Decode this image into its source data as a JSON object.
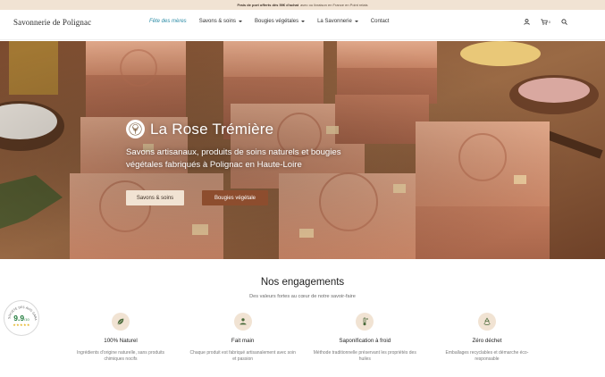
{
  "topbar": {
    "strong": "Frais de port offerts dès 59€ d'achat",
    "rest": "avec ou livraison en France en Point relais"
  },
  "header": {
    "logo": "Savonnerie de Polignac",
    "nav": [
      {
        "label": "Fête des mères",
        "active": true,
        "dropdown": false
      },
      {
        "label": "Savons & soins",
        "active": false,
        "dropdown": true
      },
      {
        "label": "Bougies végétales",
        "active": false,
        "dropdown": true
      },
      {
        "label": "La Savonnerie",
        "active": false,
        "dropdown": true
      },
      {
        "label": "Contact",
        "active": false,
        "dropdown": false
      }
    ],
    "cart_count": "0",
    "icons": [
      "user-icon",
      "cart-icon",
      "search-icon"
    ]
  },
  "hero": {
    "title": "La Rose Trémière",
    "subtitle": "Savons artisanaux, produits de soins naturels et bougies végétales fabriqués à Polignac en Haute-Loire",
    "buttons": [
      {
        "label": "Savons & soins",
        "style": "light"
      },
      {
        "label": "Bougies végétale",
        "style": "dark"
      }
    ]
  },
  "engagements": {
    "title": "Nos engagements",
    "subtitle": "Des valeurs fortes au cœur de notre savoir-faire",
    "items": [
      {
        "icon": "leaf-icon",
        "title": "100% Naturel",
        "desc": "Ingrédients d'origine naturelle, sans produits chimiques nocifs"
      },
      {
        "icon": "handmade-icon",
        "title": "Fait main",
        "desc": "Chaque produit est fabriqué artisanalement avec soin et passion"
      },
      {
        "icon": "thermometer-icon",
        "title": "Saponification à froid",
        "desc": "Méthode traditionnelle préservant les propriétés des huiles"
      },
      {
        "icon": "recycle-icon",
        "title": "Zéro déchet",
        "desc": "Emballages recyclables et démarche éco-responsable"
      }
    ]
  },
  "review_badge": {
    "score": "9.9",
    "scale": "/10",
    "arc_text": "SOCIÉTÉ DES AVIS GARANTIS"
  },
  "colors": {
    "accent_link": "#2c8ca6",
    "beige": "#f1e3d3",
    "brown": "#8d4d2e"
  }
}
